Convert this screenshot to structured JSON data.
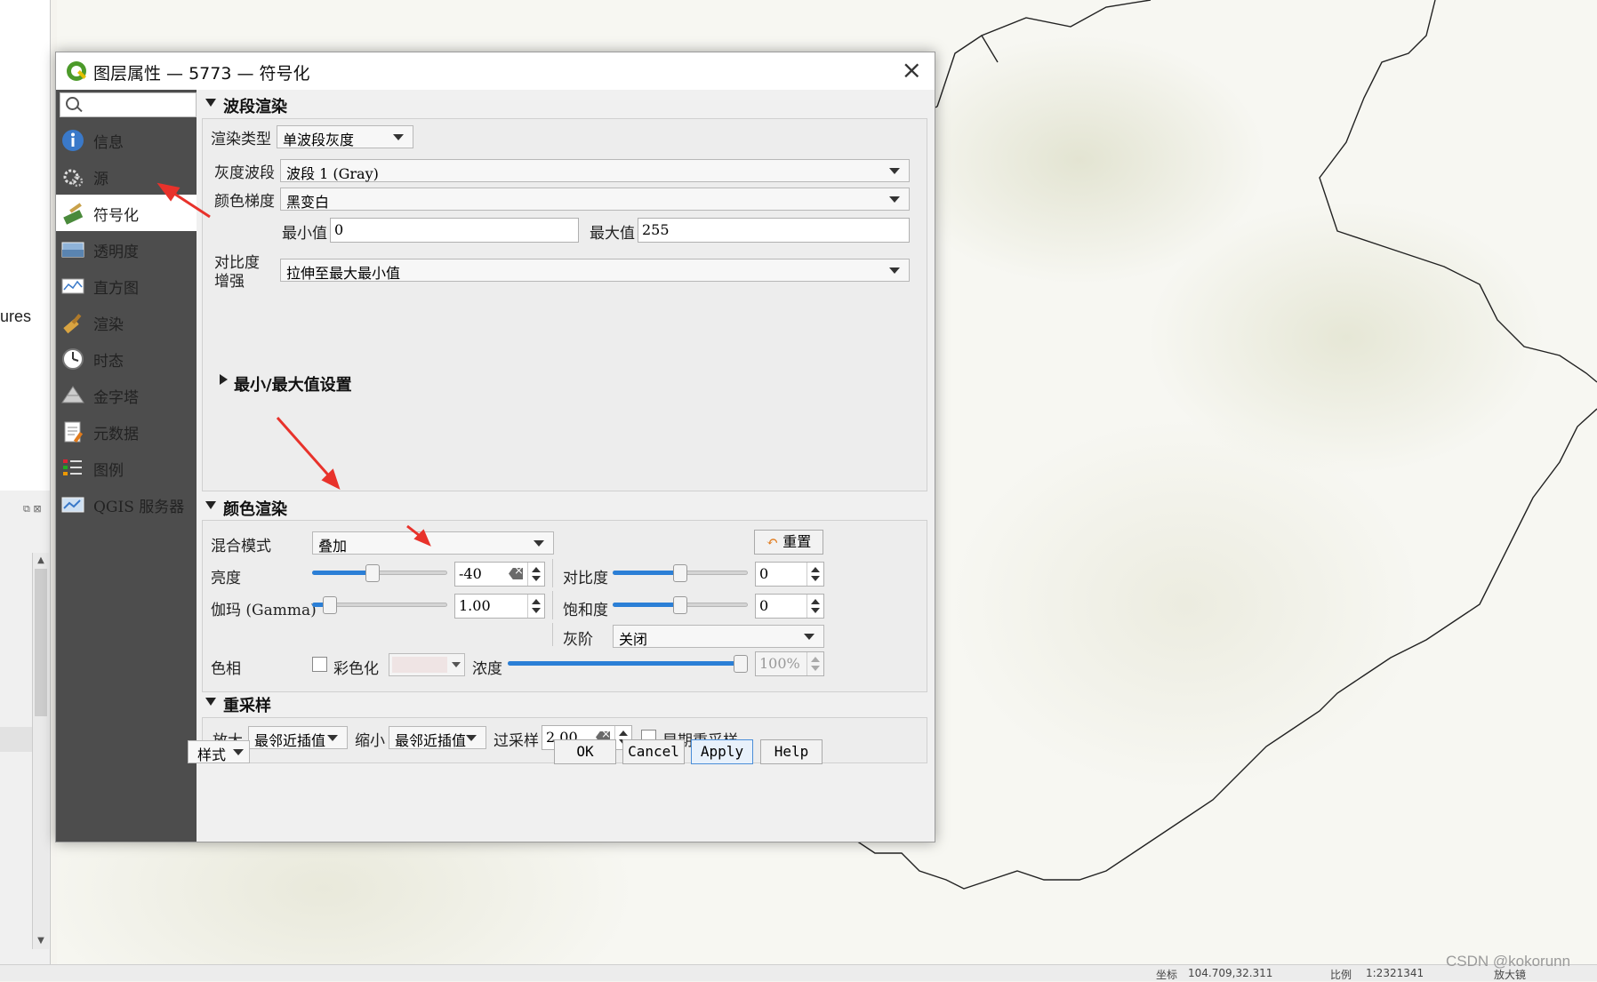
{
  "left_panel": {
    "stub_text": "ures"
  },
  "dialog": {
    "title": "图层属性 — 5773 — 符号化",
    "close_label": "×",
    "search": {
      "placeholder": ""
    },
    "nav": [
      {
        "label": "信息",
        "icon": "info-icon"
      },
      {
        "label": "源",
        "icon": "source-icon"
      },
      {
        "label": "符号化",
        "icon": "symbology-icon",
        "active": true
      },
      {
        "label": "透明度",
        "icon": "transparency-icon"
      },
      {
        "label": "直方图",
        "icon": "histogram-icon"
      },
      {
        "label": "渲染",
        "icon": "rendering-icon"
      },
      {
        "label": "时态",
        "icon": "temporal-icon"
      },
      {
        "label": "金字塔",
        "icon": "pyramids-icon"
      },
      {
        "label": "元数据",
        "icon": "metadata-icon"
      },
      {
        "label": "图例",
        "icon": "legend-icon"
      },
      {
        "label": "QGIS 服务器",
        "icon": "qgis-server-icon"
      }
    ],
    "band_rendering": {
      "header": "波段渲染",
      "render_type_label": "渲染类型",
      "render_type_value": "单波段灰度",
      "gray_band_label": "灰度波段",
      "gray_band_value": "波段 1 (Gray)",
      "color_gradient_label": "颜色梯度",
      "color_gradient_value": "黑变白",
      "min_label": "最小值",
      "min_value": "0",
      "max_label": "最大值",
      "max_value": "255",
      "contrast_label_1": "对比度",
      "contrast_label_2": "增强",
      "contrast_value": "拉伸至最大最小值",
      "minmax_settings": "最小/最大值设置"
    },
    "color_rendering": {
      "header": "颜色渲染",
      "blend_mode_label": "混合模式",
      "blend_mode_value": "叠加",
      "reset_label": "重置",
      "brightness_label": "亮度",
      "brightness_value": "-40",
      "brightness_level": 0.44,
      "contrast_label": "对比度",
      "contrast_value": "0",
      "contrast_level": 0.5,
      "gamma_label": "伽玛 (Gamma)",
      "gamma_value": "1.00",
      "gamma_level": 0.09,
      "saturation_label": "饱和度",
      "saturation_value": "0",
      "saturation_level": 0.5,
      "grayscale_label": "灰阶",
      "grayscale_value": "关闭",
      "hue_label": "色相",
      "colorize_label": "彩色化",
      "strength_label": "浓度",
      "strength_value": "100%",
      "strength_level": 1.0,
      "colorize_swatch": "#efe4e4"
    },
    "resampling": {
      "header": "重采样",
      "zoom_in_label": "放大",
      "zoom_in_value": "最邻近插值",
      "zoom_out_label": "缩小",
      "zoom_out_value": "最邻近插值",
      "oversampling_label": "过采样",
      "oversampling_value": "2.00",
      "early_resampling_label": "早期重采样"
    },
    "footer": {
      "style_label": "样式",
      "ok": "OK",
      "cancel": "Cancel",
      "apply": "Apply",
      "help": "Help"
    }
  },
  "status_bar": {
    "coord_label": "坐标",
    "coord_value": "104.709,32.311",
    "scale_label": "比例",
    "scale_value": "1:2321341",
    "magnifier_label": "放大镜"
  },
  "watermark": "CSDN @kokorunn",
  "colors": {
    "sidebar": "#4d4d4d",
    "accent": "#2b7fd6",
    "annotation": "#e8322b"
  }
}
